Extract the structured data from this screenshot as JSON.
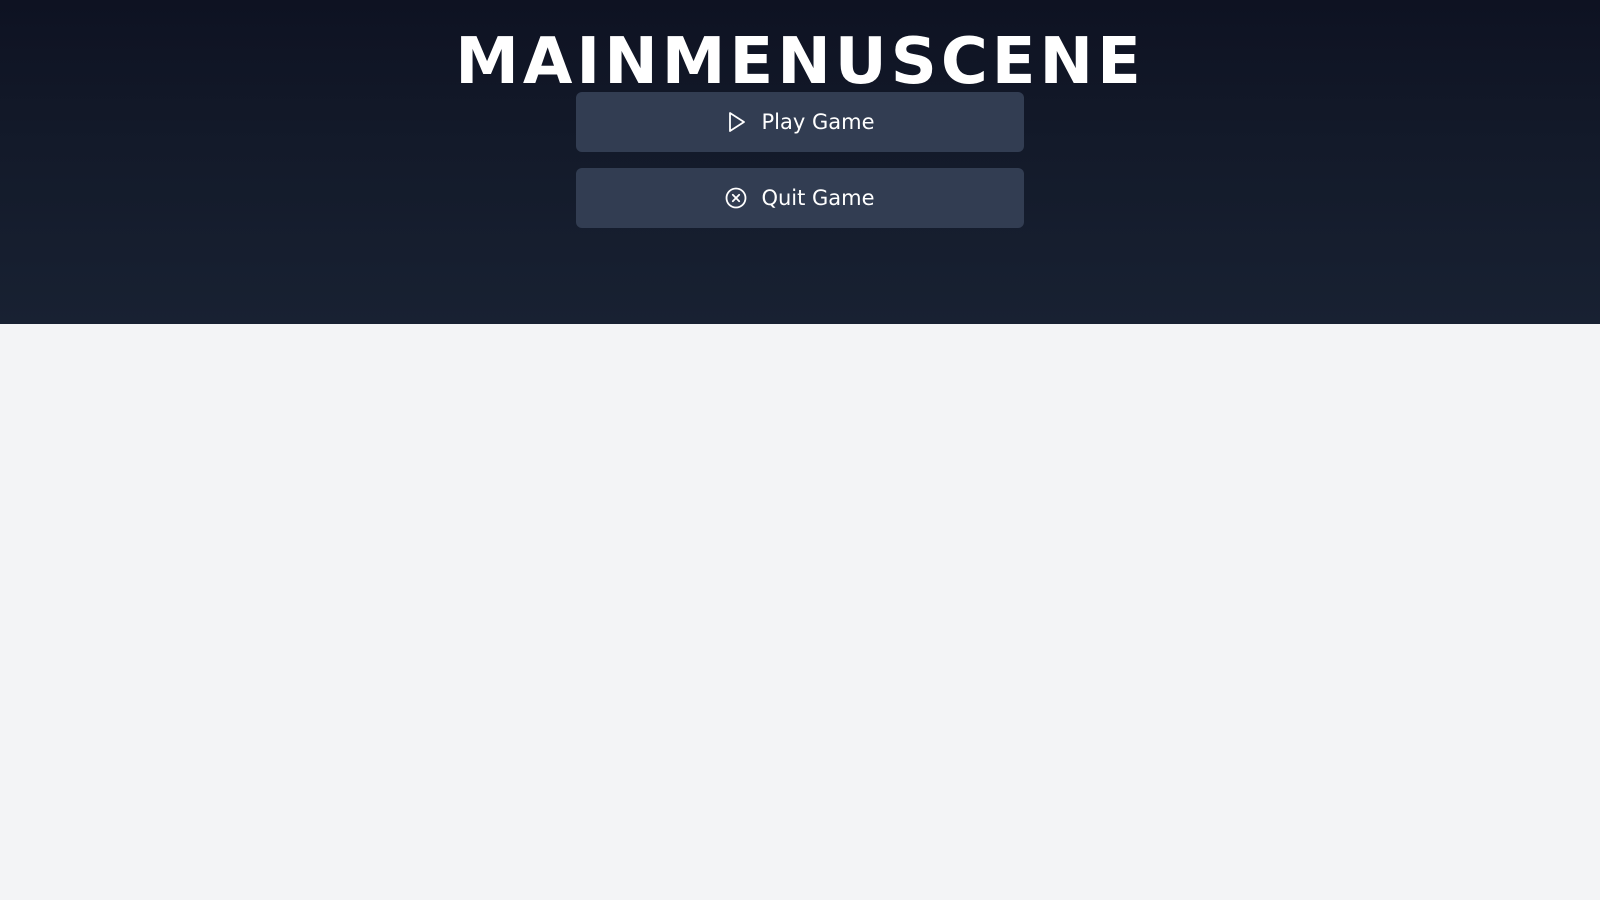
{
  "scene": {
    "title": "MAINMENUSCENE"
  },
  "menu": {
    "buttons": [
      {
        "label": "Play Game",
        "icon": "play-icon"
      },
      {
        "label": "Quit Game",
        "icon": "close-circle-icon"
      }
    ]
  },
  "colors": {
    "panel_top": "#0e1222",
    "panel_bottom": "#182132",
    "button_bg": "#323d52",
    "text": "#ffffff",
    "page_bg": "#f3f4f6"
  }
}
